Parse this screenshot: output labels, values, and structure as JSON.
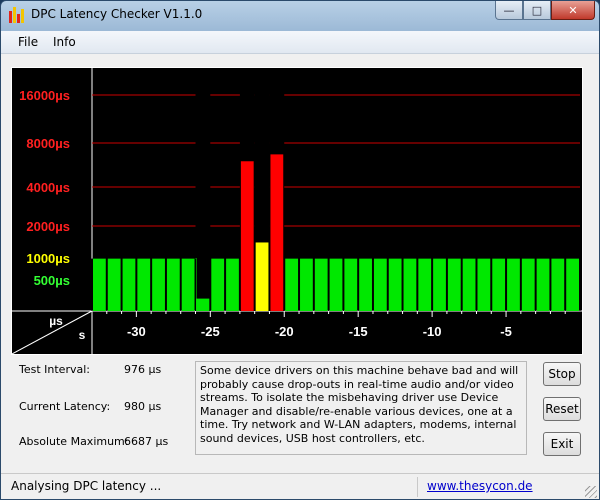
{
  "window": {
    "title": "DPC Latency Checker V1.1.0"
  },
  "menu": {
    "items": [
      "File",
      "Info"
    ]
  },
  "chart_data": {
    "type": "bar",
    "y_scale": "nonlinear",
    "y_ticks": [
      {
        "label": "16000µs",
        "color": "#ff2020"
      },
      {
        "label": "8000µs",
        "color": "#ff2020"
      },
      {
        "label": "4000µs",
        "color": "#ff2020"
      },
      {
        "label": "2000µs",
        "color": "#ff2020"
      },
      {
        "label": "1000µs",
        "color": "#ffff00"
      },
      {
        "label": "500µs",
        "color": "#33ff33"
      }
    ],
    "y_unit_label": "µs",
    "x_unit_label": "s",
    "x_ticks": [
      "-30",
      "-25",
      "-20",
      "-15",
      "-10",
      "-5"
    ],
    "x_tick_values": [
      -30,
      -25,
      -20,
      -15,
      -10,
      -5
    ],
    "xlim": [
      -33,
      0
    ],
    "bar_values_us": [
      980,
      980,
      980,
      980,
      980,
      980,
      980,
      980,
      980,
      980,
      980,
      980,
      980,
      980,
      980,
      980,
      980,
      980,
      980,
      980,
      980,
      980,
      980,
      980,
      980,
      980,
      980,
      980,
      980,
      980,
      980,
      980,
      980
    ],
    "special_bars": [
      {
        "x": -26,
        "value_us": 1000,
        "low_value_us": 200,
        "color": "split"
      },
      {
        "x": -23,
        "value_us": 6000,
        "color": "#ff0000"
      },
      {
        "x": -22,
        "value_us": 1400,
        "color": "#ffff00"
      },
      {
        "x": -21,
        "value_us": 6687,
        "color": "#ff0000"
      }
    ],
    "colors": {
      "green": "#00e800",
      "yellow": "#ffff00",
      "red": "#ff0000",
      "grid": "#cc0000",
      "background": "#000000"
    }
  },
  "stats": {
    "test_interval_label": "Test Interval:",
    "test_interval_value": "976 µs",
    "current_latency_label": "Current Latency:",
    "current_latency_value": "980 µs",
    "absolute_maximum_label": "Absolute Maximum:",
    "absolute_maximum_value": "6687 µs"
  },
  "description": "Some device drivers on this machine behave bad and will probably cause drop-outs in real-time audio and/or video streams. To isolate the misbehaving driver use Device Manager and disable/re-enable various devices, one at a time. Try network and W-LAN adapters, modems, internal sound devices, USB host controllers, etc.",
  "buttons": {
    "stop": "Stop",
    "reset": "Reset",
    "exit": "Exit"
  },
  "statusbar": {
    "text": "Analysing DPC latency ...",
    "link": "www.thesycon.de"
  }
}
